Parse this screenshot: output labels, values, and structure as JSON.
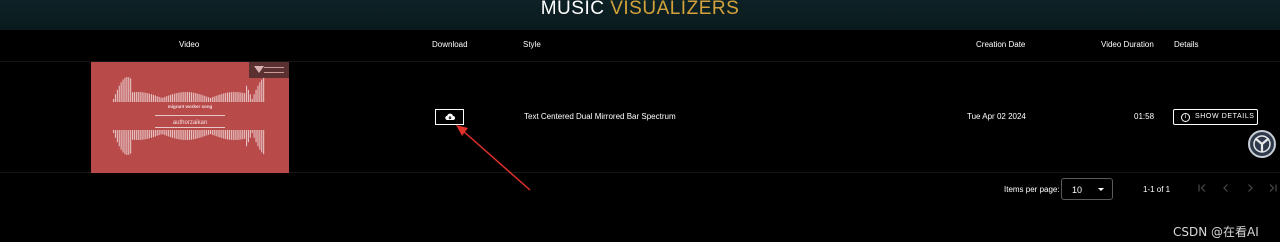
{
  "header": {
    "title_part1": "MUSIC ",
    "title_part2": "VISUALIZERS"
  },
  "table": {
    "columns": [
      "Video",
      "Download",
      "Style",
      "Creation Date",
      "Video Duration",
      "Details"
    ],
    "rows": [
      {
        "thumbnail": {
          "song_title": "migrant worker song",
          "author": "authorzaikan"
        },
        "style": "Text Centered Dual Mirrored Bar Spectrum",
        "creation_date": "Tue Apr 02 2024",
        "duration": "01:58",
        "details_label": "SHOW DETAILS",
        "download_icon": "cloud-download-icon"
      }
    ]
  },
  "pagination": {
    "items_per_page_label": "Items per page:",
    "items_per_page_value": "10",
    "range_label": "1-1 of 1"
  },
  "watermark": "CSDN @在看AI",
  "colors": {
    "accent_gold": "#d4a23a",
    "thumb_red": "#b84a4a",
    "annotation_red": "#e0302a"
  }
}
